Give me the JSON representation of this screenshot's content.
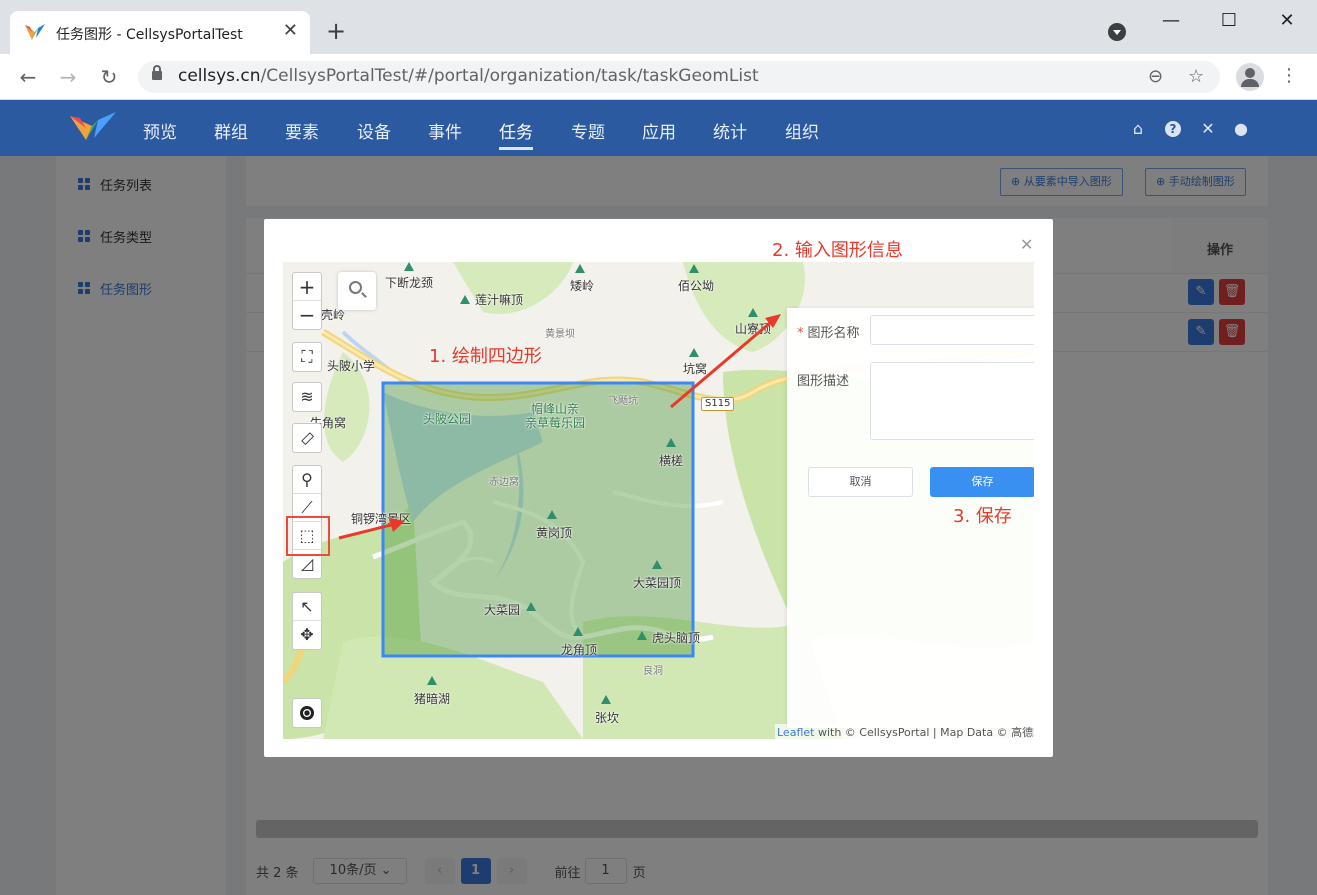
{
  "browser": {
    "tab_title": "任务图形 - CellsysPortalTest",
    "url_host": "cellsys.cn",
    "url_path": "/CellsysPortalTest/#/portal/organization/task/taskGeomList"
  },
  "nav": {
    "items": [
      "预览",
      "群组",
      "要素",
      "设备",
      "事件",
      "任务",
      "专题",
      "应用",
      "统计",
      "组织"
    ],
    "active": "任务"
  },
  "sidebar": {
    "items": [
      "任务列表",
      "任务类型",
      "任务图形"
    ],
    "active": "任务图形"
  },
  "toolbar": {
    "import_btn": "从要素中导入图形",
    "draw_btn": "手动绘制图形"
  },
  "table": {
    "header_op": "操作",
    "row_count": 2
  },
  "pager": {
    "total": "共 2 条",
    "page_size": "10条/页",
    "current_page": "1",
    "goto_label": "前往",
    "goto_value": "1",
    "page_suffix": "页"
  },
  "dialog": {
    "form": {
      "name_label": "图形名称",
      "name_value": "",
      "desc_label": "图形描述",
      "desc_value": "",
      "cancel": "取消",
      "save": "保存"
    },
    "annotations": {
      "step1": "1. 绘制四边形",
      "step2": "2. 输入图形信息",
      "step3": "3. 保存"
    },
    "map": {
      "labels": {
        "xiaduanlongjing": "下断龙颈",
        "lianzhizhangding": "莲汁嘛顶",
        "ailing": "矮岭",
        "bogongao": "佰公坳",
        "shanzhaiding": "山寮顶",
        "kengwo": "坑窝",
        "touleixiaoxue": "头陂小学",
        "niujiaowo": "牛角窝",
        "toupigongyuan": "头陂公园",
        "maofengshan": "帽峰山亲",
        "caomei": "亲草莓乐园",
        "hengcuo": "横槎",
        "tongluozhang": "铜锣湾景区",
        "huanggangding": "黄岗顶",
        "dacaiyuanding": "大菜园顶",
        "dacaiyuan": "大菜园",
        "hutounaoding": "虎头脑顶",
        "longjiaoding": "龙角顶",
        "zhuanhu": "猪暗湖",
        "zhangkan": "张坎",
        "keling": "壳岭",
        "chibianwo": "赤边窝",
        "huangdongba": "黄景坝",
        "feiyangkeng": "飞飏坑",
        "liangdong": "良洞",
        "road": "S115"
      },
      "attribution_leaflet": "Leaflet",
      "attribution_rest": " with © CellsysPortal | Map Data © 高德地图"
    }
  }
}
